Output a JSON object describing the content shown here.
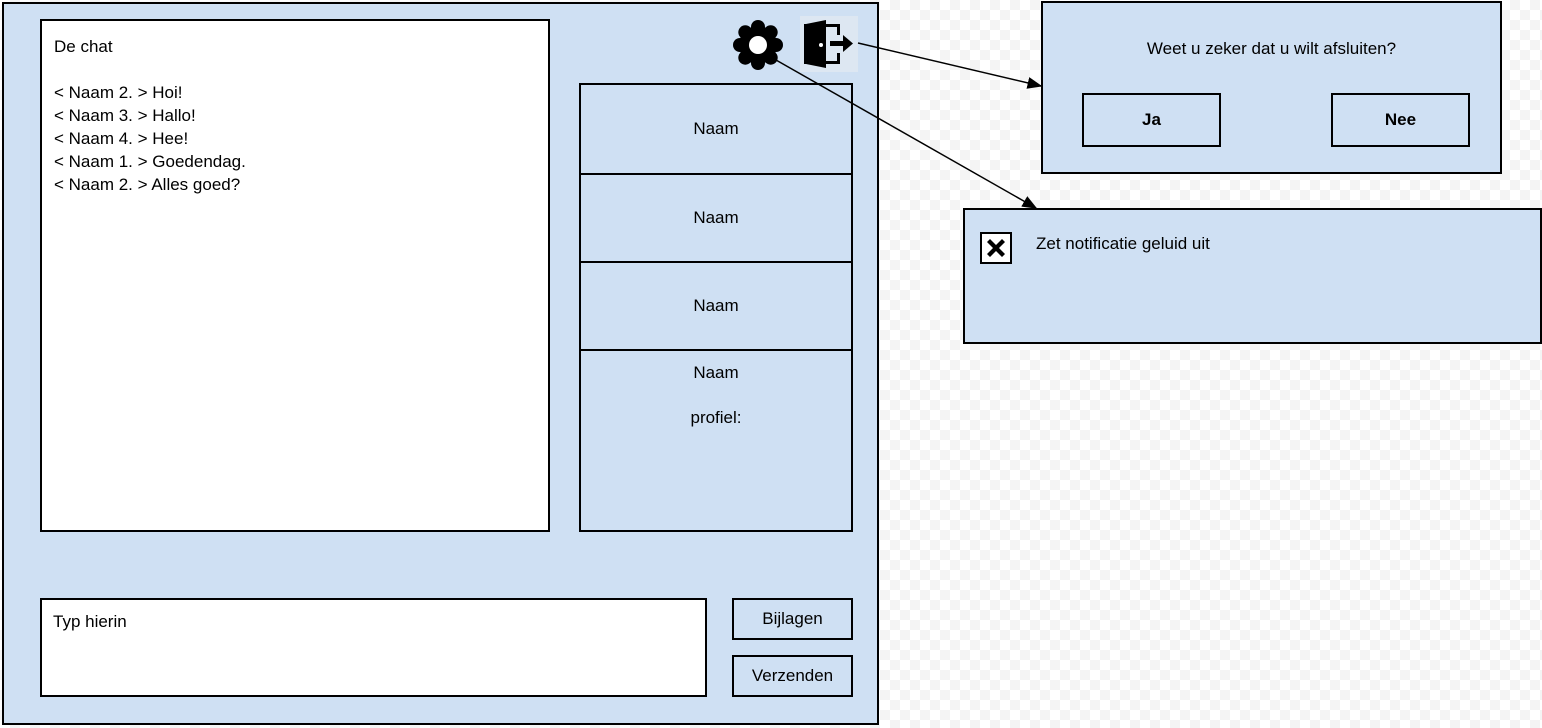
{
  "chat": {
    "title": "De chat",
    "messages": [
      "< Naam 2. > Hoi!",
      "< Naam 3. > Hallo!",
      "< Naam 4. > Hee!",
      "< Naam 1. > Goedendag.",
      "< Naam 2. > Alles goed?"
    ]
  },
  "toolbar": {
    "settings_icon": "gear-icon",
    "exit_icon": "door-exit-icon"
  },
  "users": {
    "items": [
      "Naam",
      "Naam",
      "Naam"
    ],
    "profile_name": "Naam",
    "profile_label": "profiel:"
  },
  "composer": {
    "placeholder": "Typ hierin",
    "attach_label": "Bijlagen",
    "send_label": "Verzenden"
  },
  "exit_dialog": {
    "question": "Weet u zeker dat u wilt afsluiten?",
    "yes_label": "Ja",
    "no_label": "Nee"
  },
  "settings_panel": {
    "mute_label": "Zet notificatie geluid uit",
    "mute_checked": true
  },
  "colors": {
    "panel_bg": "#cfe0f3",
    "border": "#000000"
  }
}
